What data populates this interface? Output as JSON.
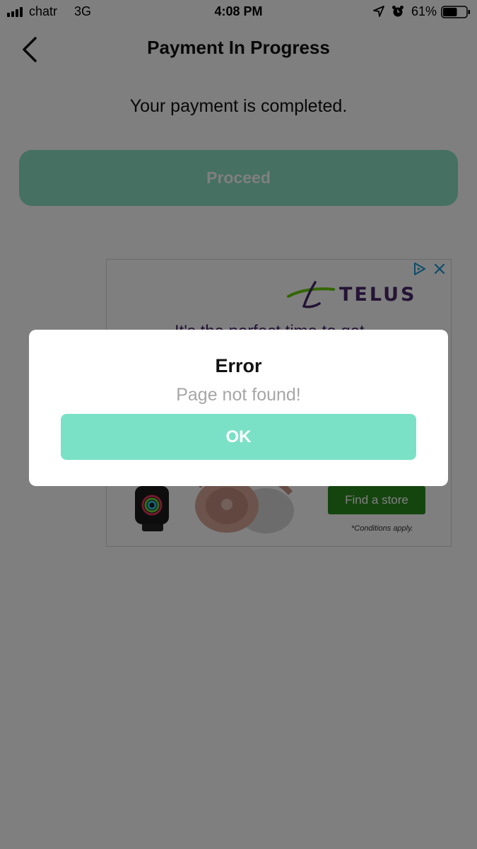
{
  "status_bar": {
    "carrier": "chatr",
    "network": "3G",
    "time": "4:08 PM",
    "battery": "61%",
    "battery_level": 0.61,
    "icons": [
      "signal-bars-icon",
      "location-arrow-icon",
      "alarm-clock-icon",
      "battery-icon"
    ]
  },
  "header": {
    "title": "Payment In Progress",
    "back_icon": "chevron-left-icon"
  },
  "main": {
    "message": "Your payment is completed.",
    "proceed_label": "Proceed"
  },
  "ad": {
    "brand": "TELUS",
    "headline": "It's the perfect time to get",
    "cta": "Find a store",
    "conditions": "*Conditions apply.",
    "icons": [
      "ad-choices-icon",
      "close-icon"
    ]
  },
  "dialog": {
    "title": "Error",
    "message": "Page not found!",
    "ok_label": "OK"
  },
  "colors": {
    "accent": "#7ae1c6",
    "proceed": "#8be0c4",
    "telus_purple": "#4b286d",
    "telus_green": "#66cc00",
    "store_button": "#2b8a1e"
  }
}
